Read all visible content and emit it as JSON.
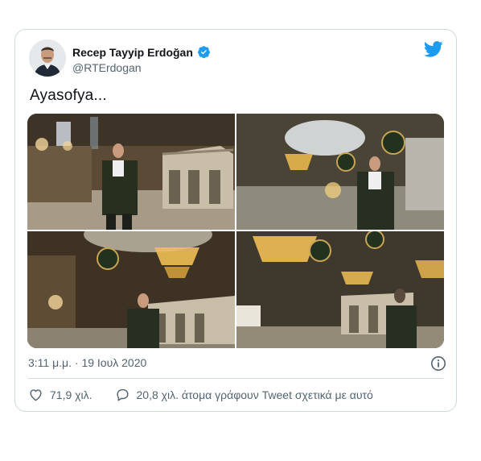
{
  "tweet": {
    "author_name": "Recep Tayyip Erdoğan",
    "handle": "@RTErdogan",
    "text": "Ayasofya...",
    "timestamp": "3:11 μ.μ. · 19 Ιουλ 2020",
    "likes": "71,9 χιλ.",
    "replies_text": "20,8 χιλ. άτομα γράφουν Tweet σχετικά με αυτό"
  },
  "icons": {
    "logo": "twitter-bird-icon",
    "verified": "verified-badge-icon",
    "info": "info-icon",
    "like": "heart-icon",
    "reply": "speech-bubble-icon"
  },
  "colors": {
    "brand": "#1d9bf0",
    "secondary_text": "#536471",
    "border": "#cfd9de"
  }
}
